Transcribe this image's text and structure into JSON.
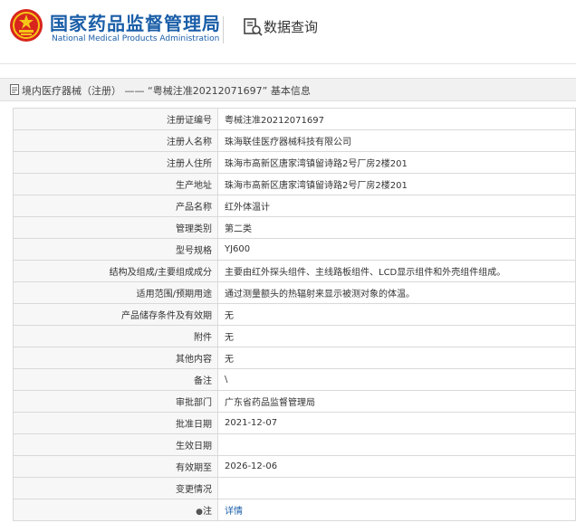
{
  "header": {
    "logo_cn": "国家药品监督管理局",
    "logo_en": "National Medical Products Administration",
    "query_title": "数据查询",
    "brand_color": "#1a5ea8",
    "emblem_color": "#d8251d"
  },
  "breadcrumb": {
    "text": "境内医疗器械（注册） —— “粤械注准20212071697” 基本信息"
  },
  "rows": [
    {
      "label": "注册证编号",
      "value": "粤械注准20212071697"
    },
    {
      "label": "注册人名称",
      "value": "珠海联佳医疗器械科技有限公司"
    },
    {
      "label": "注册人住所",
      "value": "珠海市高新区唐家湾镇留诗路2号厂房2楼201"
    },
    {
      "label": "生产地址",
      "value": "珠海市高新区唐家湾镇留诗路2号厂房2楼201"
    },
    {
      "label": "产品名称",
      "value": "红外体温计"
    },
    {
      "label": "管理类别",
      "value": "第二类"
    },
    {
      "label": "型号规格",
      "value": "YJ600"
    },
    {
      "label": "结构及组成/主要组成成分",
      "value": "主要由红外探头组件、主线路板组件、LCD显示组件和外壳组件组成。"
    },
    {
      "label": "适用范围/预期用途",
      "value": "通过测量额头的热辐射来显示被测对象的体温。"
    },
    {
      "label": "产品储存条件及有效期",
      "value": "无"
    },
    {
      "label": "附件",
      "value": "无"
    },
    {
      "label": "其他内容",
      "value": "无"
    },
    {
      "label": "备注",
      "value": "\\"
    },
    {
      "label": "审批部门",
      "value": "广东省药品监督管理局"
    },
    {
      "label": "批准日期",
      "value": "2021-12-07"
    },
    {
      "label": "生效日期",
      "value": ""
    },
    {
      "label": "有效期至",
      "value": "2026-12-06"
    },
    {
      "label": "变更情况",
      "value": ""
    }
  ],
  "note_row": {
    "pin": "●",
    "label": "注",
    "link": "详情"
  }
}
